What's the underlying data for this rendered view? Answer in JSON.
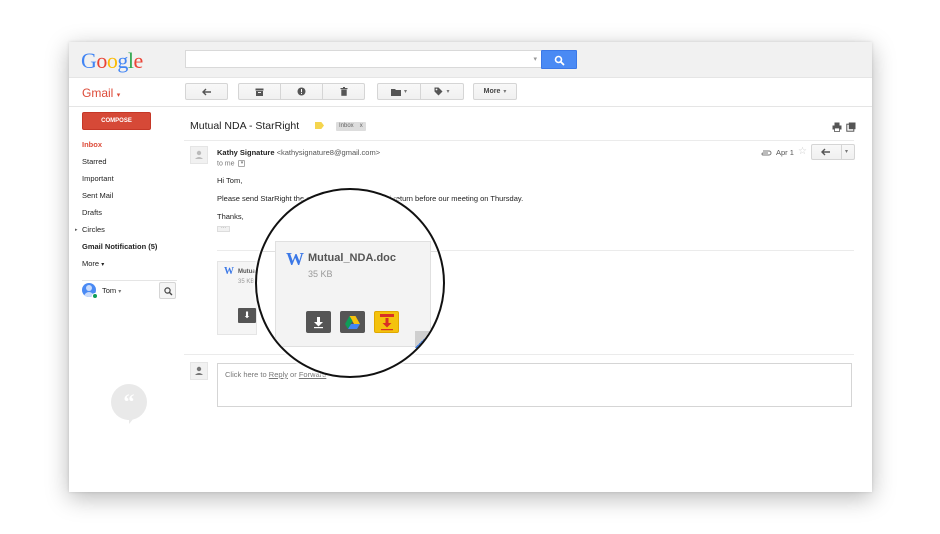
{
  "header": {
    "logo_letters": [
      {
        "char": "G",
        "color": "#4285f4"
      },
      {
        "char": "o",
        "color": "#ea4335"
      },
      {
        "char": "o",
        "color": "#fbbc05"
      },
      {
        "char": "g",
        "color": "#4285f4"
      },
      {
        "char": "l",
        "color": "#34a853"
      },
      {
        "char": "e",
        "color": "#ea4335"
      }
    ],
    "search": {
      "placeholder": "",
      "value": "",
      "button_icon": "search-icon"
    }
  },
  "toolbar": {
    "app_label": "Gmail",
    "app_caret": "▾",
    "buttons": [
      {
        "name": "back-button",
        "icon": "back-arrow-icon"
      },
      {
        "name": "archive-button",
        "icon": "archive-icon"
      },
      {
        "name": "report-spam-button",
        "icon": "spam-icon"
      },
      {
        "name": "delete-button",
        "icon": "trash-icon"
      },
      {
        "name": "move-to-button",
        "icon": "folder-icon",
        "dropdown": "▾"
      },
      {
        "name": "labels-button",
        "icon": "tag-icon",
        "dropdown": "▾"
      }
    ],
    "more_label": "More",
    "more_caret": "▾"
  },
  "sidebar": {
    "compose_label": "COMPOSE",
    "items": [
      {
        "label": "Inbox",
        "active": true
      },
      {
        "label": "Starred"
      },
      {
        "label": "Important"
      },
      {
        "label": "Sent Mail"
      },
      {
        "label": "Drafts"
      },
      {
        "label": "Circles",
        "expander": "▸"
      },
      {
        "label": "Gmail Notification (5)",
        "bold": true
      },
      {
        "label": "More",
        "caret": "▾"
      }
    ],
    "chat": {
      "user_name": "Tom",
      "caret": "▾",
      "status_color": "#0f9d58"
    }
  },
  "thread": {
    "subject": "Mutual NDA - StarRight",
    "label_chip": "Inbox",
    "label_chip_close": "x",
    "label_color": "#f5d54e"
  },
  "message": {
    "sender_name": "Kathy Signature",
    "sender_email": "<kathysignature8@gmail.com>",
    "to": "to me",
    "date": "Apr 1",
    "star": "☆",
    "greeting": "Hi Tom,",
    "body": "Please send StarRight the attached NDA to sign and return before our meeting on Thursday.",
    "signoff": "Thanks,",
    "ellipsis": "···"
  },
  "attachment": {
    "icon_letter": "W",
    "filename": "Mutual_NDA.doc",
    "filename_short": "Mutua",
    "size": "35 KB",
    "actions": [
      {
        "name": "download",
        "icon": "download-icon"
      },
      {
        "name": "save-to-drive",
        "icon": "google-drive-icon"
      },
      {
        "name": "docusign",
        "icon": "docusign-icon"
      }
    ],
    "accent_color": "#2a73e8"
  },
  "reply": {
    "prefix": "Click here to ",
    "reply_link": "Reply",
    "middle": " or ",
    "forward_link": "Forward"
  }
}
